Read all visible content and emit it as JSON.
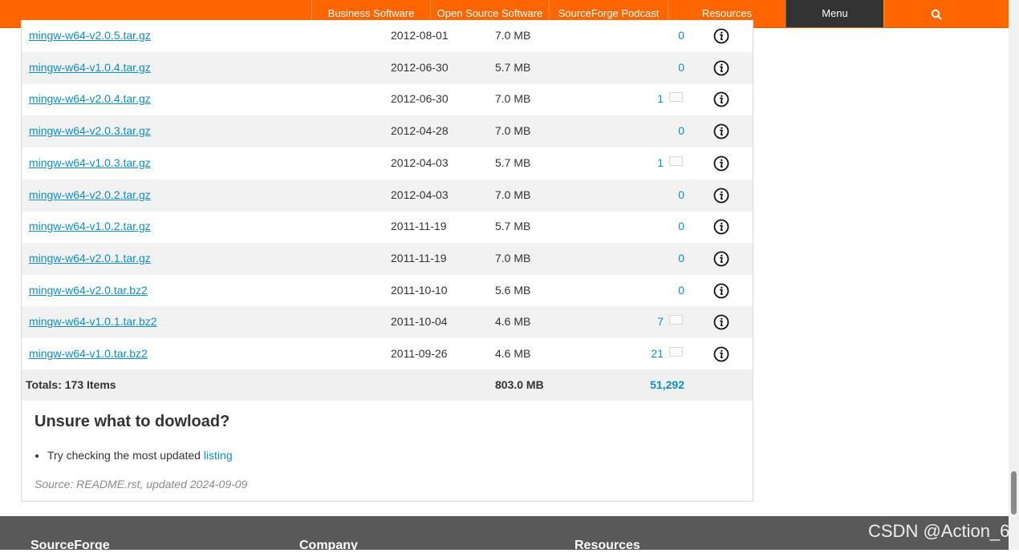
{
  "nav": {
    "items": [
      {
        "label": "Business Software"
      },
      {
        "label": "Open Source Software"
      },
      {
        "label": "SourceForge Podcast"
      },
      {
        "label": "Resources"
      },
      {
        "label": "Menu"
      }
    ],
    "search_icon": "search-icon"
  },
  "files": [
    {
      "name": "mingw-w64-v2.0.5.tar.gz",
      "date": "2012-08-01",
      "size": "7.0 MB",
      "downloads": "0",
      "has_sparkline": false
    },
    {
      "name": "mingw-w64-v1.0.4.tar.gz",
      "date": "2012-06-30",
      "size": "5.7 MB",
      "downloads": "0",
      "has_sparkline": false
    },
    {
      "name": "mingw-w64-v2.0.4.tar.gz",
      "date": "2012-06-30",
      "size": "7.0 MB",
      "downloads": "1",
      "has_sparkline": true
    },
    {
      "name": "mingw-w64-v2.0.3.tar.gz",
      "date": "2012-04-28",
      "size": "7.0 MB",
      "downloads": "0",
      "has_sparkline": false
    },
    {
      "name": "mingw-w64-v1.0.3.tar.gz",
      "date": "2012-04-03",
      "size": "5.7 MB",
      "downloads": "1",
      "has_sparkline": true
    },
    {
      "name": "mingw-w64-v2.0.2.tar.gz",
      "date": "2012-04-03",
      "size": "7.0 MB",
      "downloads": "0",
      "has_sparkline": false
    },
    {
      "name": "mingw-w64-v1.0.2.tar.gz",
      "date": "2011-11-19",
      "size": "5.7 MB",
      "downloads": "0",
      "has_sparkline": false
    },
    {
      "name": "mingw-w64-v2.0.1.tar.gz",
      "date": "2011-11-19",
      "size": "7.0 MB",
      "downloads": "0",
      "has_sparkline": false
    },
    {
      "name": "mingw-w64-v2.0.tar.bz2",
      "date": "2011-10-10",
      "size": "5.6 MB",
      "downloads": "0",
      "has_sparkline": false
    },
    {
      "name": "mingw-w64-v1.0.1.tar.bz2",
      "date": "2011-10-04",
      "size": "4.6 MB",
      "downloads": "7",
      "has_sparkline": true
    },
    {
      "name": "mingw-w64-v1.0.tar.bz2",
      "date": "2011-09-26",
      "size": "4.6 MB",
      "downloads": "21",
      "has_sparkline": true
    }
  ],
  "totals": {
    "label": "Totals: 173 Items",
    "size": "803.0 MB",
    "downloads": "51,292"
  },
  "readme": {
    "heading": "Unsure what to dowload?",
    "bullet_text": "Try checking the most updated ",
    "bullet_link": "listing",
    "source": "Source: README.rst, updated 2024-09-09"
  },
  "footer": {
    "columns": [
      "SourceForge",
      "Company",
      "Resources"
    ]
  },
  "watermark": "CSDN @Action_6",
  "colors": {
    "nav": "#ff6600",
    "menu": "#333333",
    "link": "#0e8fc4",
    "footer": "#595959"
  }
}
